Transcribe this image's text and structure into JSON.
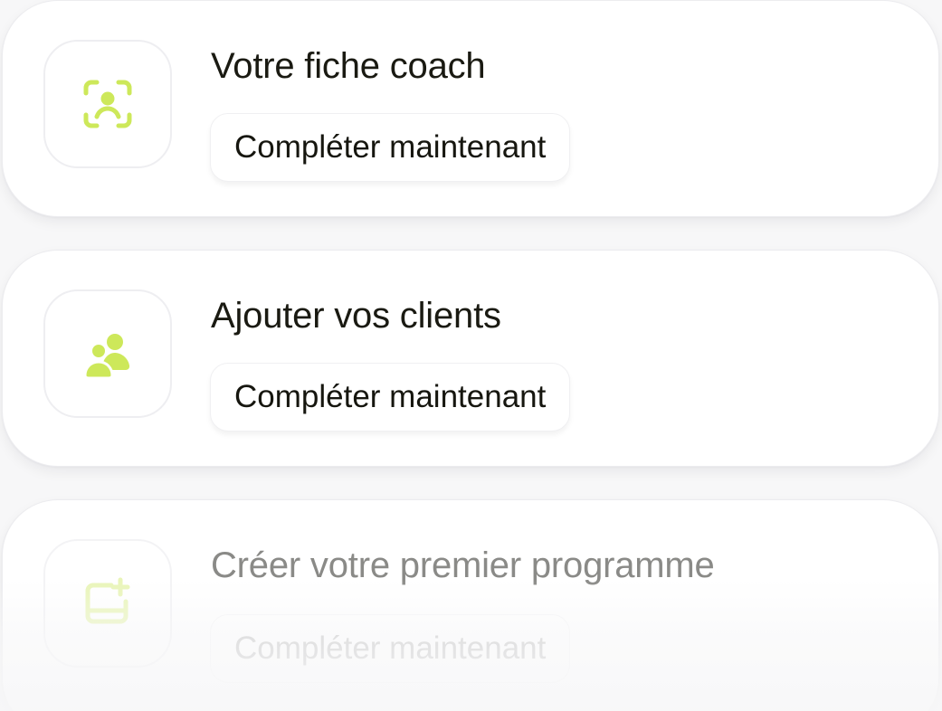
{
  "colors": {
    "accent": "#cde85a",
    "accent_faded": "#e9f5b8",
    "title_text": "#1a1a12",
    "muted_text": "#8a8a87"
  },
  "cards": [
    {
      "icon": "face-scan-icon",
      "title": "Votre fiche coach",
      "action_label": "Compléter maintenant"
    },
    {
      "icon": "users-icon",
      "title": "Ajouter vos clients",
      "action_label": "Compléter maintenant"
    },
    {
      "icon": "add-program-icon",
      "title": "Créer votre premier programme",
      "action_label": "Compléter maintenant"
    }
  ]
}
